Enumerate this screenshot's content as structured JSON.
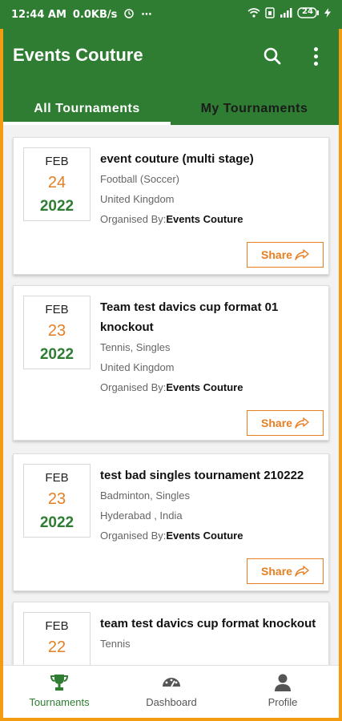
{
  "status_bar": {
    "time": "12:44 AM",
    "speed": "0.0KB/s",
    "dots": "⋯",
    "battery": "24"
  },
  "app": {
    "title": "Events Couture"
  },
  "tabs": [
    {
      "label": "All Tournaments",
      "active": true
    },
    {
      "label": "My Tournaments",
      "active": false
    }
  ],
  "events": [
    {
      "month": "FEB",
      "day": "24",
      "year": "2022",
      "title": "event couture (multi stage)",
      "sport": "Football (Soccer)",
      "location": "United Kingdom",
      "organised_prefix": "Organised By:",
      "organiser": "Events Couture",
      "share_label": "Share"
    },
    {
      "month": "FEB",
      "day": "23",
      "year": "2022",
      "title": "Team test davics cup format 01 knockout",
      "sport": "Tennis, Singles",
      "location": "United Kingdom",
      "organised_prefix": "Organised By:",
      "organiser": "Events Couture",
      "share_label": "Share"
    },
    {
      "month": "FEB",
      "day": "23",
      "year": "2022",
      "title": "test bad singles tournament 210222",
      "sport": "Badminton, Singles",
      "location": "Hyderabad , India",
      "organised_prefix": "Organised By:",
      "organiser": "Events Couture",
      "share_label": "Share"
    },
    {
      "month": "FEB",
      "day": "22",
      "year": "",
      "title": "team test davics cup format knockout",
      "sport": "Tennis",
      "location": "",
      "organised_prefix": "",
      "organiser": "",
      "share_label": ""
    }
  ],
  "bottom_nav": [
    {
      "label": "Tournaments",
      "icon": "trophy-icon",
      "active": true
    },
    {
      "label": "Dashboard",
      "icon": "dashboard-icon",
      "active": false
    },
    {
      "label": "Profile",
      "icon": "profile-icon",
      "active": false
    }
  ],
  "colors": {
    "primary": "#2e7d32",
    "accent": "#e67e22",
    "frame": "#f39c12"
  }
}
